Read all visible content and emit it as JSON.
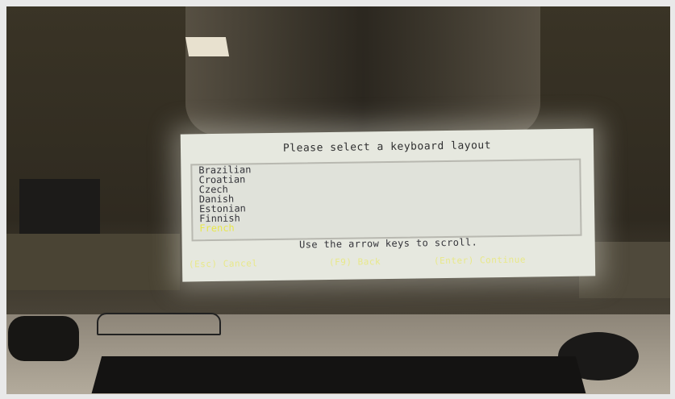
{
  "installer": {
    "title": "Please select a keyboard layout",
    "layouts": [
      "Brazilian",
      "Croatian",
      "Czech",
      "Danish",
      "Estonian",
      "Finnish",
      "French"
    ],
    "selected_index": 6,
    "hint": "Use the arrow keys to scroll.",
    "buttons": {
      "cancel": "(Esc) Cancel",
      "back": "(F9) Back",
      "continue": "(Enter) Continue"
    }
  },
  "colors": {
    "dialog_bg": "#e6e8df",
    "selected_text": "#e8e84c",
    "button_text": "#e8e88a"
  }
}
